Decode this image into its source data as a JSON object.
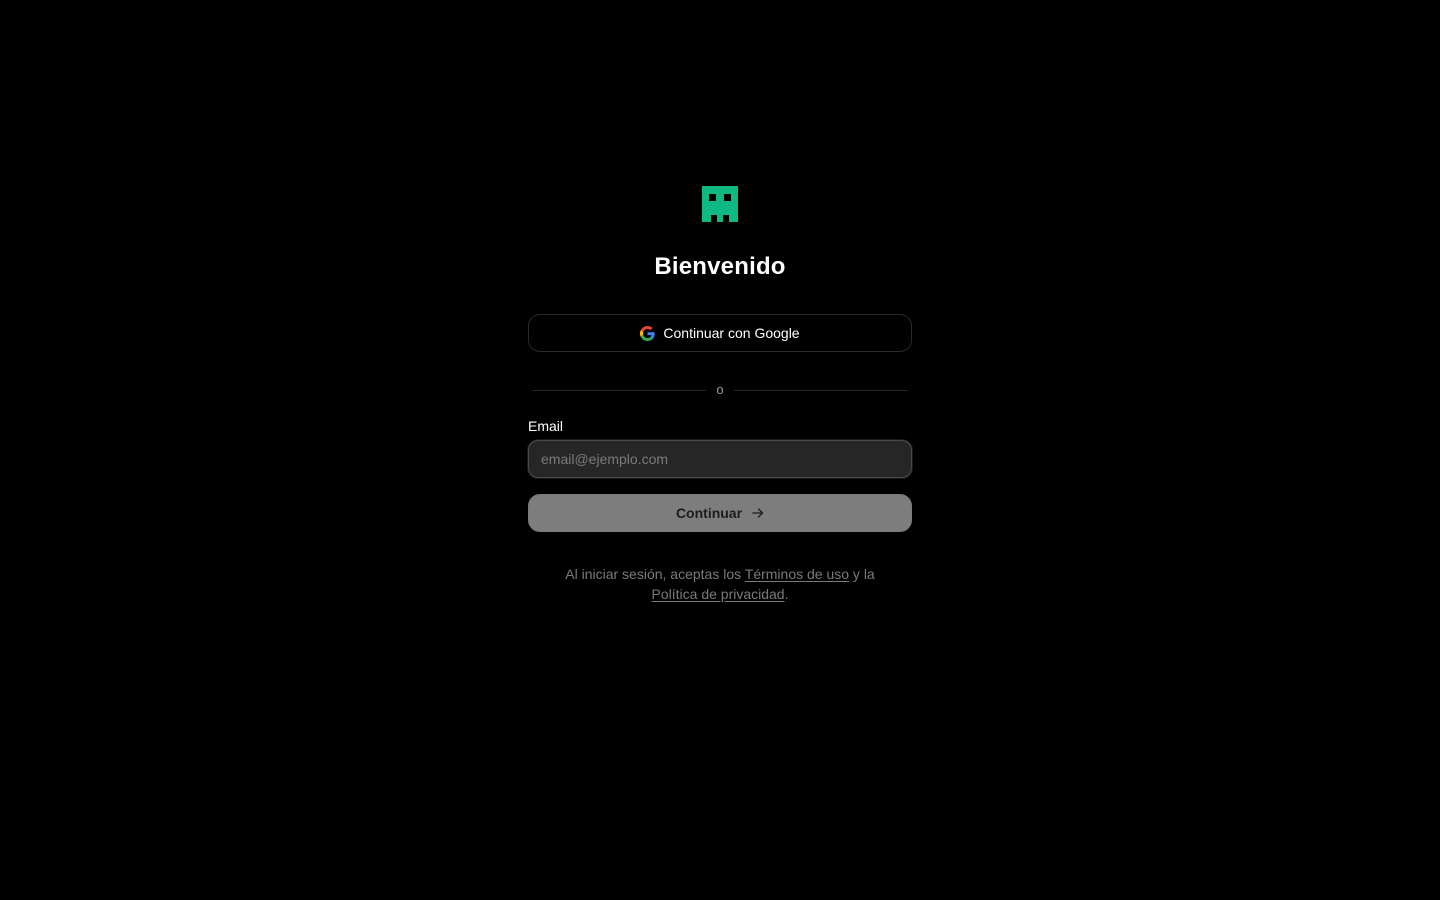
{
  "brand": {
    "logo_icon": "pixel-robot-logo-icon",
    "accent_color": "#10b981"
  },
  "header": {
    "title": "Bienvenido"
  },
  "google_button": {
    "label": "Continuar con Google",
    "icon": "google-icon"
  },
  "divider": {
    "text": "o"
  },
  "email_field": {
    "label": "Email",
    "placeholder": "email@ejemplo.com",
    "value": ""
  },
  "continue_button": {
    "label": "Continuar",
    "icon": "arrow-right-icon"
  },
  "legal": {
    "prefix": "Al iniciar sesión, aceptas los ",
    "terms_link": "Términos de uso",
    "middle": " y la",
    "privacy_link": "Política de privacidad",
    "suffix": "."
  }
}
